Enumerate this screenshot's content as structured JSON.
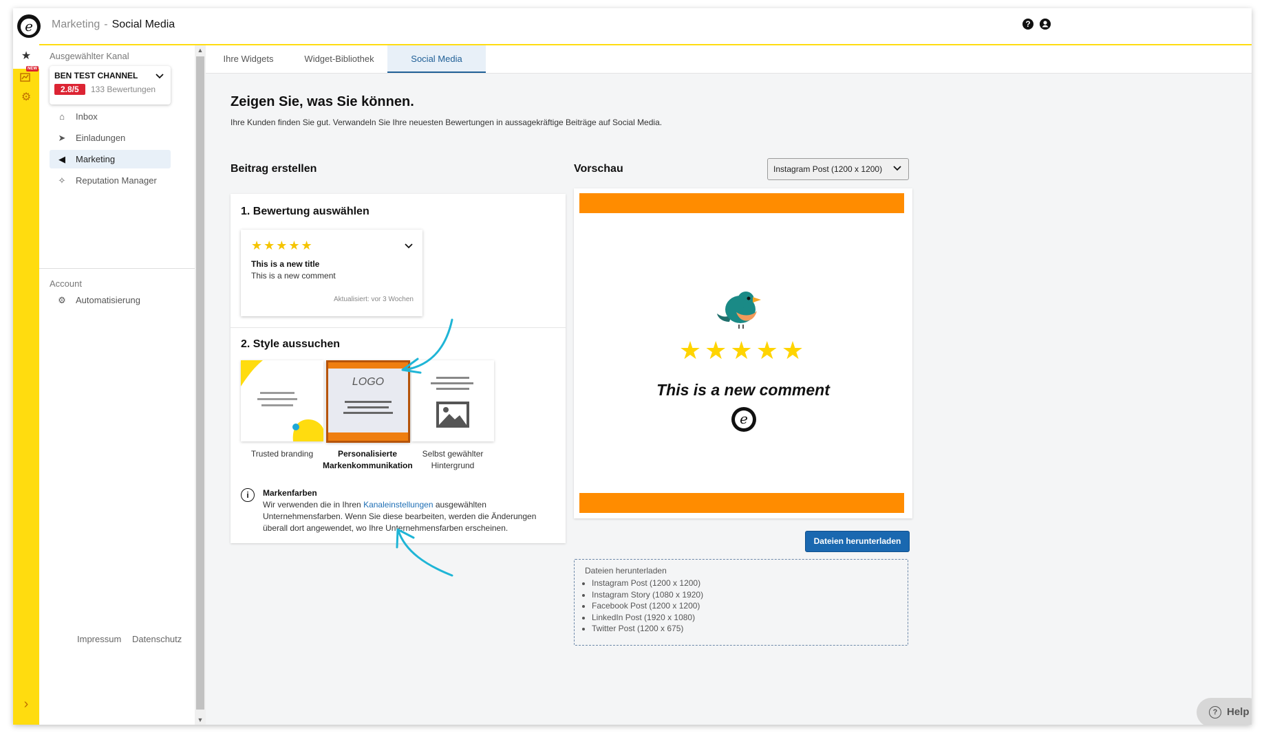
{
  "header": {
    "section": "Marketing",
    "separator": "-",
    "current": "Social Media",
    "help_icon": "question-icon",
    "user_icon": "user-icon"
  },
  "rail": {
    "items": [
      {
        "icon": "star-icon",
        "glyph": "★"
      },
      {
        "icon": "chart-icon",
        "badge": "NEW"
      },
      {
        "icon": "gear-icon",
        "glyph": "⚙"
      }
    ],
    "expand_icon": "chevron-right-icon",
    "expand_glyph": "›"
  },
  "sidebar": {
    "channel_label": "Ausgewählter Kanal",
    "channel": {
      "name": "BEN TEST CHANNEL",
      "score": "2.8/5",
      "reviews": "133 Bewertungen"
    },
    "nav": [
      {
        "label": "Inbox",
        "icon": "inbox-icon",
        "glyph": "⌂"
      },
      {
        "label": "Einladungen",
        "icon": "send-icon",
        "glyph": "➤"
      },
      {
        "label": "Marketing",
        "icon": "megaphone-icon",
        "glyph": "◀",
        "active": true
      },
      {
        "label": "Reputation Manager",
        "icon": "sparkle-icon",
        "glyph": "✧"
      }
    ],
    "account_label": "Account",
    "account_nav": [
      {
        "label": "Automatisierung",
        "icon": "robot-icon",
        "glyph": "⚙"
      }
    ],
    "footer": {
      "impressum": "Impressum",
      "datenschutz": "Datenschutz"
    }
  },
  "tabs": [
    {
      "label": "Ihre Widgets"
    },
    {
      "label": "Widget-Bibliothek"
    },
    {
      "label": "Social Media",
      "active": true
    }
  ],
  "main": {
    "title": "Zeigen Sie, was Sie können.",
    "subtitle": "Ihre Kunden finden Sie gut. Verwandeln Sie Ihre neuesten Bewertungen in aussagekräftige Beiträge auf Social Media.",
    "create_heading": "Beitrag erstellen",
    "step1": "1. Bewertung auswählen",
    "review": {
      "stars": "★★★★★",
      "rating": 5,
      "title": "This is a new title",
      "comment": "This is a new comment",
      "updated": "Aktualisiert: vor 3 Wochen"
    },
    "step2": "2. Style aussuchen",
    "styles": [
      {
        "label": "Trusted branding",
        "selected": false
      },
      {
        "label": "Personalisierte Markenkommunikation",
        "selected": true,
        "tile_text": "LOGO"
      },
      {
        "label": "Selbst gewählter Hintergrund",
        "selected": false
      }
    ],
    "info": {
      "title": "Markenfarben",
      "text_before": "Wir verwenden die in Ihren ",
      "link": "Kanaleinstellungen",
      "text_after": " ausgewählten Unternehmensfarben. Wenn Sie diese bearbeiten, werden die Änderungen überall dort angewendet, wo Ihre Unternehmensfarben erscheinen."
    }
  },
  "preview": {
    "heading": "Vorschau",
    "format_selected": "Instagram Post (1200 x 1200)",
    "stars": "★★★★★",
    "comment": "This is a new comment",
    "accent_color": "#ff8c00",
    "star_color": "#ffd400",
    "download_button": "Dateien herunterladen",
    "downloads_title": "Dateien herunterladen",
    "downloads": [
      "Instagram Post (1200 x 1200)",
      "Instagram Story (1080 x 1920)",
      "Facebook Post (1200 x 1200)",
      "LinkedIn Post (1920 x 1080)",
      "Twitter Post (1200 x 675)"
    ]
  },
  "help": {
    "label": "Help",
    "icon": "help-circle-icon"
  },
  "colors": {
    "brand_yellow": "#ffdc0f",
    "link_blue": "#1f6fb5",
    "score_red": "#dc2433",
    "annotation": "#1fb5d6"
  }
}
